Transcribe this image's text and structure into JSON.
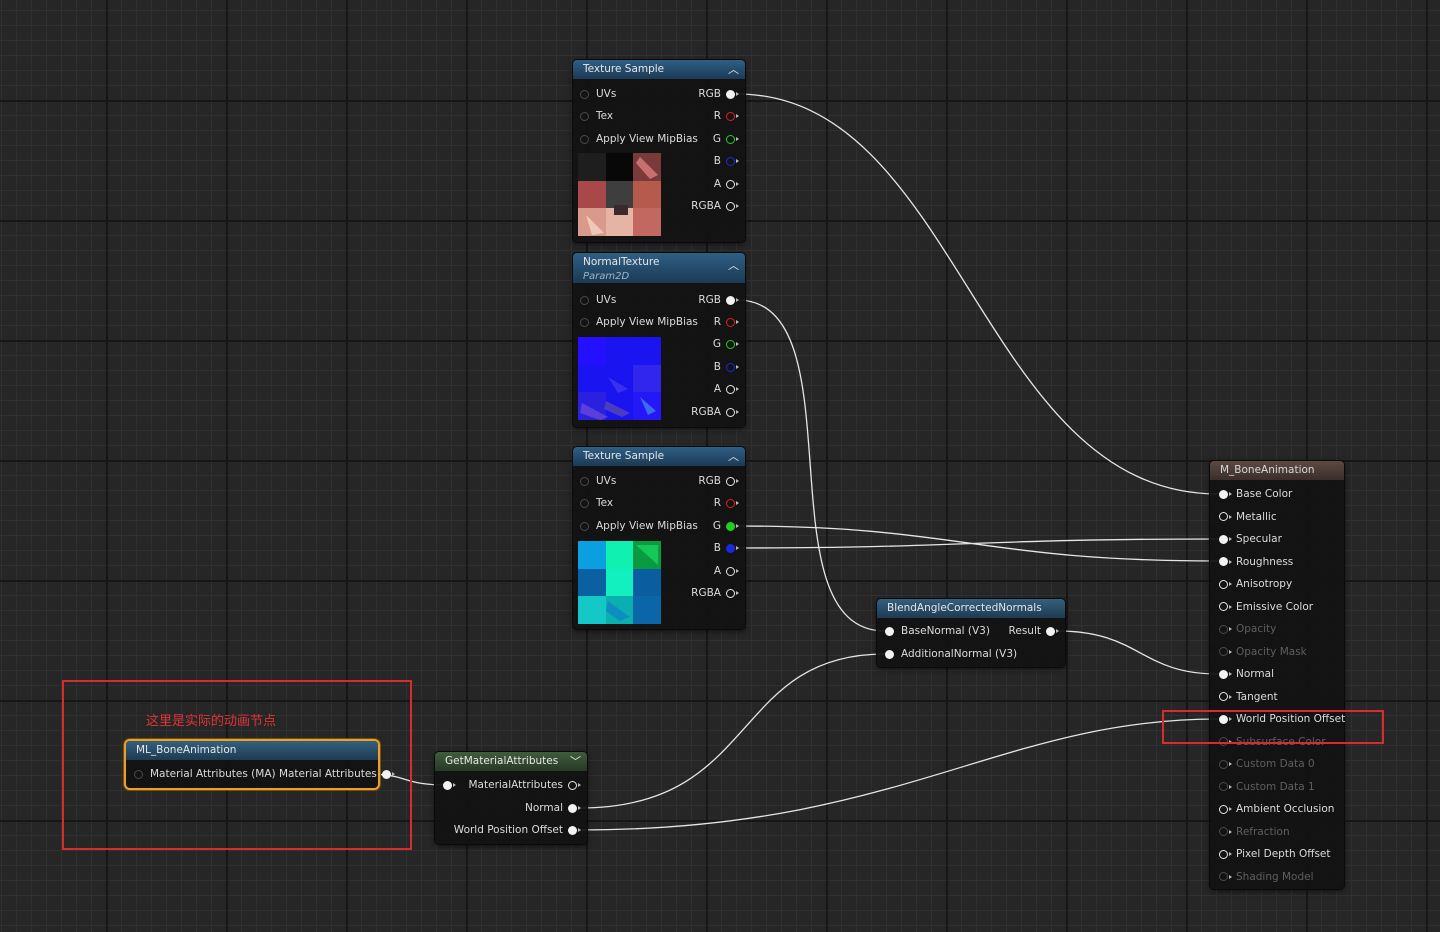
{
  "annotation": {
    "label": "这里是实际的动画节点"
  },
  "nodes": {
    "tex1": {
      "title": "Texture Sample",
      "inputs": [
        "UVs",
        "Tex",
        "Apply View MipBias"
      ],
      "outputs": [
        "RGB",
        "R",
        "G",
        "B",
        "A",
        "RGBA"
      ]
    },
    "normal": {
      "title": "NormalTexture",
      "subtitle": "Param2D",
      "inputs": [
        "UVs",
        "Apply View MipBias"
      ],
      "outputs": [
        "RGB",
        "R",
        "G",
        "B",
        "A",
        "RGBA"
      ]
    },
    "tex2": {
      "title": "Texture Sample",
      "inputs": [
        "UVs",
        "Tex",
        "Apply View MipBias"
      ],
      "outputs": [
        "RGB",
        "R",
        "G",
        "B",
        "A",
        "RGBA"
      ]
    },
    "blend": {
      "title": "BlendAngleCorrectedNormals",
      "inputs": [
        "BaseNormal (V3)",
        "AdditionalNormal (V3)"
      ],
      "output": "Result"
    },
    "mlbone": {
      "title": "ML_BoneAnimation",
      "output": "Material Attributes (MA) Material Attributes"
    },
    "getattr": {
      "title": "GetMaterialAttributes",
      "outputs": [
        "MaterialAttributes",
        "Normal",
        "World Position Offset"
      ]
    },
    "material": {
      "title": "M_BoneAnimation",
      "inputs": [
        {
          "label": "Base Color",
          "enabled": true
        },
        {
          "label": "Metallic",
          "enabled": true
        },
        {
          "label": "Specular",
          "enabled": true
        },
        {
          "label": "Roughness",
          "enabled": true
        },
        {
          "label": "Anisotropy",
          "enabled": true
        },
        {
          "label": "Emissive Color",
          "enabled": true
        },
        {
          "label": "Opacity",
          "enabled": false
        },
        {
          "label": "Opacity Mask",
          "enabled": false
        },
        {
          "label": "Normal",
          "enabled": true
        },
        {
          "label": "Tangent",
          "enabled": true
        },
        {
          "label": "World Position Offset",
          "enabled": true
        },
        {
          "label": "Subsurface Color",
          "enabled": false
        },
        {
          "label": "Custom Data 0",
          "enabled": false
        },
        {
          "label": "Custom Data 1",
          "enabled": false
        },
        {
          "label": "Ambient Occlusion",
          "enabled": true
        },
        {
          "label": "Refraction",
          "enabled": false
        },
        {
          "label": "Pixel Depth Offset",
          "enabled": true
        },
        {
          "label": "Shading Model",
          "enabled": false
        }
      ]
    }
  },
  "colors": {
    "wire": "#e6e6e6",
    "highlight": "#d92b2b",
    "selection": "#e9a227"
  }
}
